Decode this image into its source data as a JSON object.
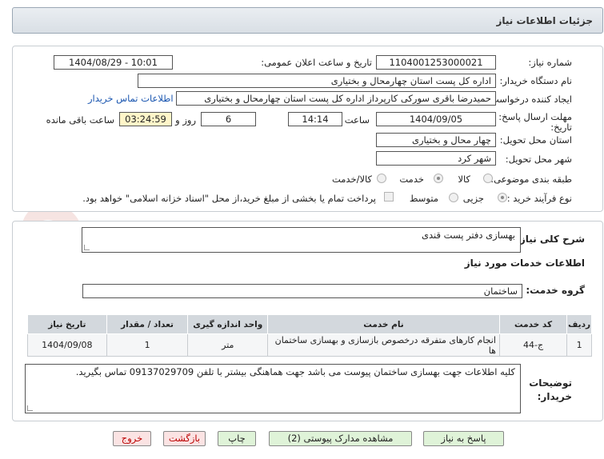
{
  "header": {
    "title": "جزئیات اطلاعات نیاز"
  },
  "form": {
    "need_number_label": "شماره نیاز:",
    "need_number": "1104001253000021",
    "announce_label": "تاریخ و ساعت اعلان عمومی:",
    "announce_value": "1404/08/29 - 10:01",
    "buyer_org_label": "نام دستگاه خریدار:",
    "buyer_org": "اداره کل پست استان چهارمحال و بختیاری",
    "creator_label": "ایجاد کننده درخواست:",
    "creator": "حمیدرضا باقری سورکی کارپرداز اداره کل پست استان چهارمحال و بختیاری",
    "contact_link": "اطلاعات تماس خریدار",
    "deadline_label_1": "مهلت ارسال پاسخ: تا",
    "deadline_label_2": "تاریخ:",
    "deadline_date": "1404/09/05",
    "time_label": "ساعت",
    "deadline_time": "14:14",
    "days_value": "6",
    "days_label": "روز و",
    "remaining_time": "03:24:59",
    "remaining_label": "ساعت باقی مانده",
    "province_label": "استان محل تحویل:",
    "province": "چهار محال و بختیاری",
    "city_label": "شهر محل تحویل:",
    "city": "شهر کرد",
    "category_label": "طبقه بندی موضوعی:",
    "category_options": [
      "کالا",
      "خدمت",
      "کالا/خدمت"
    ],
    "process_label": "نوع فرآیند خرید :",
    "process_options": [
      "جزیی",
      "متوسط"
    ],
    "treasury_note": "پرداخت تمام یا بخشی از مبلغ خرید،از محل \"اسناد خزانه اسلامی\" خواهد بود."
  },
  "details": {
    "desc_label": "شرح کلی نیاز:",
    "desc_value": "بهسازی دفتر پست قندی",
    "services_title": "اطلاعات خدمات مورد نیاز",
    "service_group_label": "گروه خدمت:",
    "service_group": "ساختمان",
    "table": {
      "headers": [
        "ردیف",
        "کد خدمت",
        "نام خدمت",
        "واحد اندازه گیری",
        "تعداد / مقدار",
        "تاریخ نیاز"
      ],
      "rows": [
        [
          "1",
          "ج-44",
          "انجام کارهای متفرقه درخصوص بازسازی و بهسازی ساختمان ها",
          "متر",
          "1",
          "1404/09/08"
        ]
      ]
    },
    "buyer_notes_label_1": "توضیحات",
    "buyer_notes_label_2": "خریدار:",
    "buyer_notes": "کلیه اطلاعات جهت بهسازی ساختمان پیوست می باشد جهت هماهنگی بیشتر با تلفن 09137029709 تماس بگیرید."
  },
  "watermark": {
    "text": "AriaTender.net"
  },
  "buttons": {
    "reply": "پاسخ به نیاز",
    "attachments": "مشاهده مدارک پیوستی (2)",
    "print": "چاپ",
    "back": "بازگشت",
    "exit": "خروج"
  }
}
